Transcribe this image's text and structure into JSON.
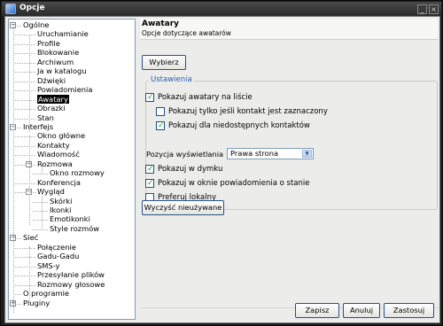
{
  "window": {
    "title": "Opcje",
    "min_label": "_",
    "close_label": "×"
  },
  "tree": {
    "nodes": [
      {
        "label": "Ogólne",
        "level": 0,
        "toggle": "−"
      },
      {
        "label": "Uruchamianie",
        "level": 1
      },
      {
        "label": "Profile",
        "level": 1
      },
      {
        "label": "Blokowanie",
        "level": 1
      },
      {
        "label": "Archiwum",
        "level": 1
      },
      {
        "label": "Ja w katalogu",
        "level": 1
      },
      {
        "label": "Dźwięki",
        "level": 1
      },
      {
        "label": "Powiadomienia",
        "level": 1
      },
      {
        "label": "Awatary",
        "level": 1,
        "selected": true
      },
      {
        "label": "Obrazki",
        "level": 1
      },
      {
        "label": "Stan",
        "level": 1
      },
      {
        "label": "Interfejs",
        "level": 0,
        "toggle": "−"
      },
      {
        "label": "Okno główne",
        "level": 1
      },
      {
        "label": "Kontakty",
        "level": 1
      },
      {
        "label": "Wiadomość",
        "level": 1
      },
      {
        "label": "Rozmowa",
        "level": 1,
        "toggle": "−"
      },
      {
        "label": "Okno rozmowy",
        "level": 2
      },
      {
        "label": "Konferencja",
        "level": 1
      },
      {
        "label": "Wygląd",
        "level": 1,
        "toggle": "−"
      },
      {
        "label": "Skórki",
        "level": 2
      },
      {
        "label": "Ikonki",
        "level": 2
      },
      {
        "label": "Emotikonki",
        "level": 2
      },
      {
        "label": "Style rozmów",
        "level": 2
      },
      {
        "label": "Sieć",
        "level": 0,
        "toggle": "−"
      },
      {
        "label": "Połączenie",
        "level": 1
      },
      {
        "label": "Gadu-Gadu",
        "level": 1
      },
      {
        "label": "SMS-y",
        "level": 1
      },
      {
        "label": "Przesyłanie plików",
        "level": 1
      },
      {
        "label": "Rozmowy głosowe",
        "level": 1
      },
      {
        "label": "O programie",
        "level": 0
      },
      {
        "label": "Pluginy",
        "level": 0,
        "toggle": "+"
      }
    ]
  },
  "header": {
    "title": "Awatary",
    "subtitle": "Opcje dotyczące awatarów"
  },
  "choose_button": "Wybierz",
  "settings": {
    "group_title": "Ustawienia",
    "show_avatars_list": {
      "label": "Pokazuj awatary na liście",
      "checked": true
    },
    "only_if_selected": {
      "label": "Pokazuj tylko jeśli kontakt jest zaznaczony",
      "checked": false
    },
    "show_unavailable": {
      "label": "Pokazuj dla niedostępnych kontaktów",
      "checked": true
    },
    "window_position": {
      "label": "Pozycja wyświetlania",
      "value": "Prawa strona"
    },
    "show_in_tooltip": {
      "label": "Pokazuj w dymku",
      "checked": true
    },
    "show_in_notify": {
      "label": "Pokazuj w oknie powiadomienia o stanie",
      "checked": true
    },
    "prefer_local": {
      "label": "Preferuj lokalny",
      "checked": false
    }
  },
  "clear_unused_button": "Wyczyść nieużywane",
  "footer": {
    "ok": "Zapisz",
    "cancel": "Anuluj",
    "apply": "Zastosuj"
  },
  "colors": {
    "accent": "#2a5db0",
    "check": "#21a121",
    "selection": "#000000"
  }
}
